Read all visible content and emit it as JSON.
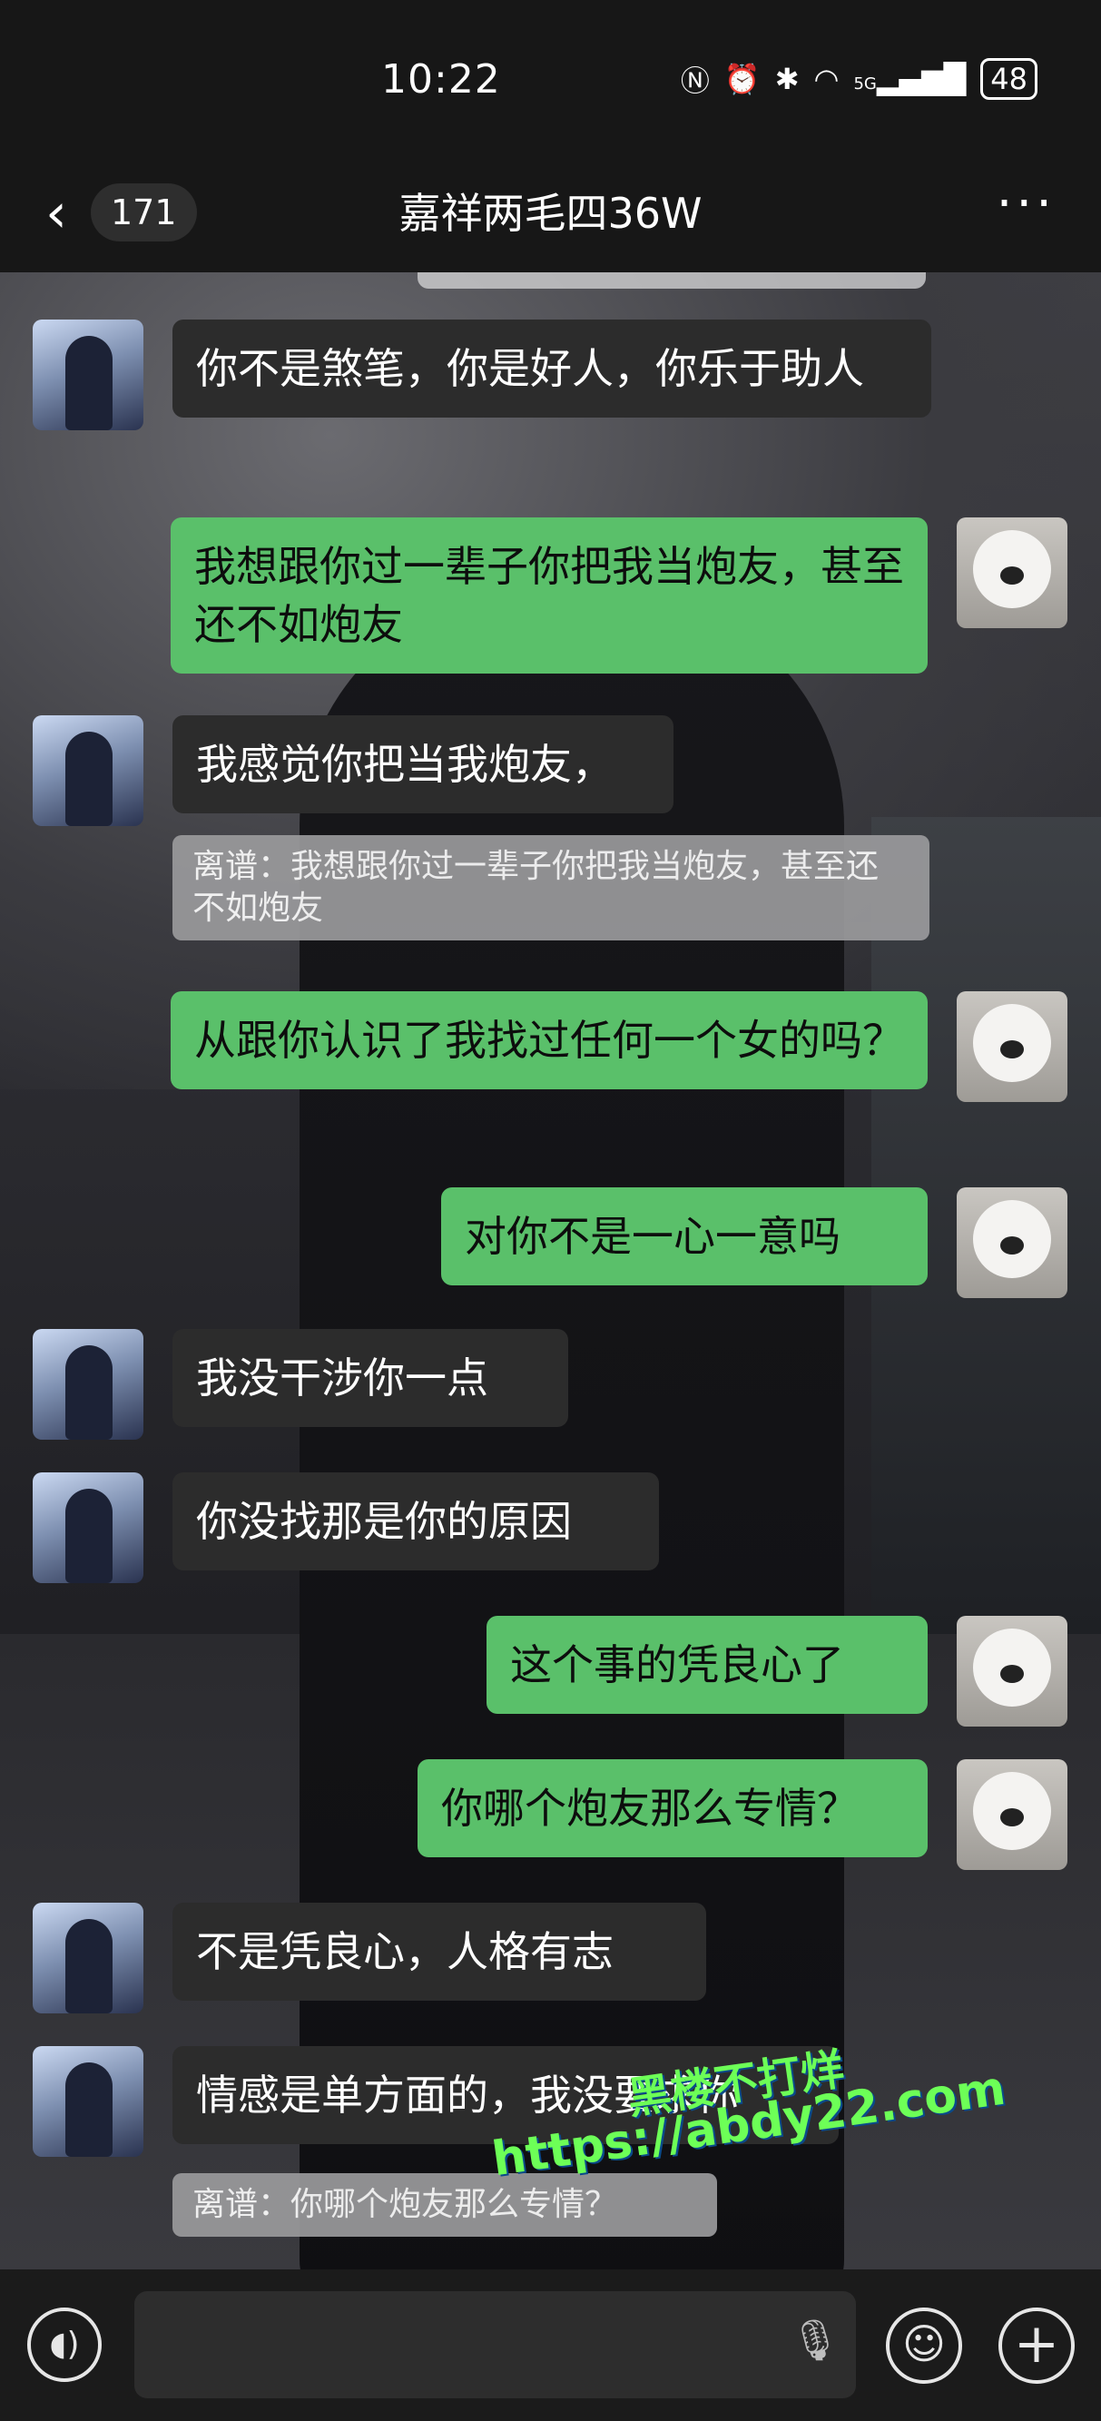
{
  "status_bar": {
    "time": "10:22",
    "icons": [
      "nfc-icon",
      "alarm-icon",
      "bluetooth-icon",
      "wifi-icon",
      "5g-signal-icon"
    ],
    "network": "5G",
    "battery": "48"
  },
  "header": {
    "back_icon": "chevron-left-icon",
    "unread_count": "171",
    "title": "嘉祥两毛四36W",
    "more_icon": "more-dots-icon"
  },
  "messages": [
    {
      "side": "in",
      "text": "你不是煞笔，你是好人，你乐于助人"
    },
    {
      "side": "out",
      "text": "我想跟你过一辈子你把我当炮友，甚至还不如炮友"
    },
    {
      "side": "in",
      "text": "我感觉你把当我炮友，"
    },
    {
      "side": "quote",
      "text": "离谱：我想跟你过一辈子你把我当炮友，甚至还不如炮友"
    },
    {
      "side": "out",
      "text": "从跟你认识了我找过任何一个女的吗？"
    },
    {
      "side": "out",
      "text": "对你不是一心一意吗"
    },
    {
      "side": "in",
      "text": "我没干涉你一点"
    },
    {
      "side": "in",
      "text": "你没找那是你的原因"
    },
    {
      "side": "out",
      "text": "这个事的凭良心了"
    },
    {
      "side": "out",
      "text": "你哪个炮友那么专情？"
    },
    {
      "side": "in",
      "text": "不是凭良心，人格有志"
    },
    {
      "side": "in",
      "text": "情感是单方面的，我没要求你"
    },
    {
      "side": "quote",
      "text": "离谱：你哪个炮友那么专情？"
    }
  ],
  "watermark": {
    "line1": "黑楼不打烊",
    "line2": "https://abdy22.com"
  },
  "input_bar": {
    "voice_icon": "voice-icon",
    "mic_icon": "mic-icon",
    "emoji_icon": "emoji-icon",
    "plus_icon": "plus-icon"
  },
  "colors": {
    "incoming_bubble": "#2c2c2c",
    "outgoing_bubble": "#5ac06a",
    "quote_bg": "#9a9a9c"
  }
}
